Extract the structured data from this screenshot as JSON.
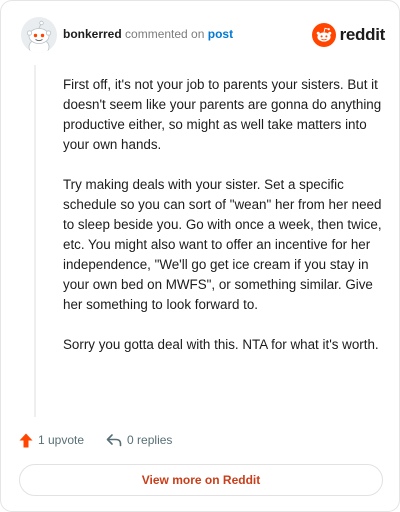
{
  "comment": {
    "username": "bonkerred",
    "action_text": "commented on",
    "post_link": "post",
    "paragraphs": [
      "First off, it's not your job to parents your sisters. But it doesn't seem like your parents are gonna do anything productive either, so might as well take matters into your own hands.",
      "Try making deals with your sister. Set a specific schedule so you can sort of \"wean\" her from her need to sleep beside you. Go with once a week, then twice, etc. You might also want to offer an incentive for her independence, \"We'll go get ice cream if you stay in your own bed on MWFS\", or something similar. Give her something to look forward to.",
      "Sorry you gotta deal with this. NTA for what it's worth."
    ]
  },
  "brand": {
    "wordmark": "reddit",
    "icon": "reddit-logo-icon",
    "color": "#ff4500"
  },
  "actions": {
    "upvote_label": "1 upvote",
    "replies_label": "0 replies"
  },
  "footer": {
    "view_more_label": "View more on Reddit"
  },
  "colors": {
    "accent": "#ff4500",
    "link": "#0079d3",
    "button_text": "#c83e1a"
  }
}
